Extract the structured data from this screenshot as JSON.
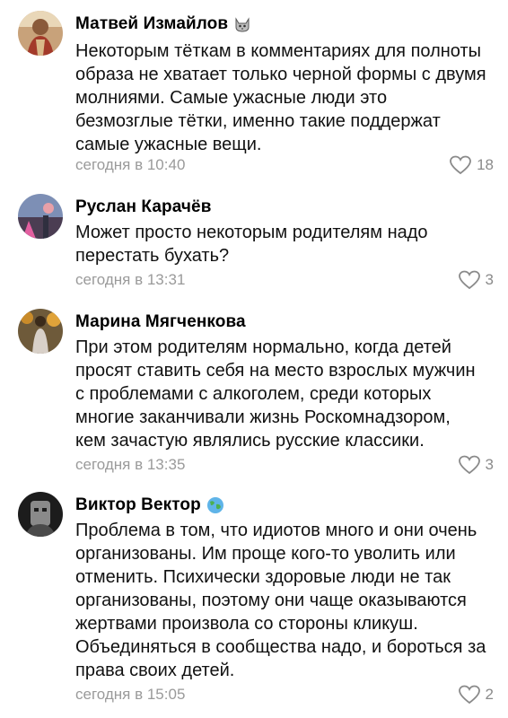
{
  "comments": [
    {
      "author": "Матвей Измайлов",
      "badge": "cat-emoji-badge",
      "text_lines": [
        "Некоторым тёткам в комментариях для полноты",
        "образа не хватает только черной формы с двумя",
        "молниями. Самые ужасные люди это",
        "безмозглые тётки, именно такие поддержат",
        "самые ужасные вещи."
      ],
      "time": "сегодня в 10:40",
      "likes": "18"
    },
    {
      "author": "Руслан Карачёв",
      "text_lines": [
        "Может просто некоторым родителям надо",
        "перестать бухать?"
      ],
      "time": "сегодня в 13:31",
      "likes": "3"
    },
    {
      "author": "Марина Мягченкова",
      "text_lines": [
        "При этом родителям нормально, когда детей",
        "просят ставить себя на место взрослых мужчин",
        "с проблемами с алкоголем, среди которых",
        "многие заканчивали жизнь Роскомнадзором,",
        "кем зачастую являлись русские классики."
      ],
      "time": "сегодня в 13:35",
      "likes": "3"
    },
    {
      "author": "Виктор Вектор",
      "badge": "globe-emoji-badge",
      "text_lines": [
        "Проблема в том, что идиотов много и они очень",
        "организованы. Им проще кого-то уволить или",
        "отменить. Психически здоровые люди не так",
        "организованы, поэтому они чаще оказываются",
        "жертвами произвола со стороны кликуш.",
        "Объединяться в сообщества надо, и бороться за",
        "права своих детей."
      ],
      "time": "сегодня в 15:05",
      "likes": "2"
    }
  ],
  "colors": {
    "meta_text": "#9a9a9a",
    "like_icon": "#8a8a8a",
    "body_text": "#111111"
  }
}
